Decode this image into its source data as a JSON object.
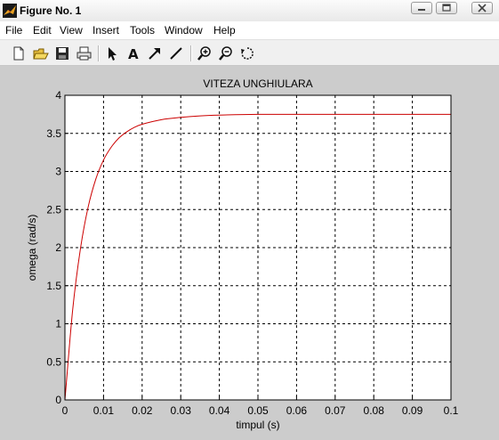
{
  "window": {
    "title": "Figure No. 1"
  },
  "menu": [
    "File",
    "Edit",
    "View",
    "Insert",
    "Tools",
    "Window",
    "Help"
  ],
  "toolbar": {
    "icons": [
      "new-figure-icon",
      "open-file-icon",
      "save-icon",
      "print-icon",
      "select-arrow-icon",
      "insert-text-icon",
      "insert-arrow-icon",
      "insert-line-icon",
      "zoom-in-icon",
      "zoom-out-icon",
      "rotate-3d-icon"
    ]
  },
  "colors": {
    "figure_bg": "#cccccc",
    "line": "#cc0000",
    "axes_bg": "#ffffff"
  },
  "chart_data": {
    "type": "line",
    "title": "VITEZA UNGHIULARA",
    "xlabel": "timpul (s)",
    "ylabel": "omega (rad/s)",
    "xlim": [
      0,
      0.1
    ],
    "ylim": [
      0,
      4
    ],
    "xticks": [
      0,
      0.01,
      0.02,
      0.03,
      0.04,
      0.05,
      0.06,
      0.07,
      0.08,
      0.09,
      0.1
    ],
    "xtick_labels": [
      "0",
      "0.01",
      "0.02",
      "0.03",
      "0.04",
      "0.05",
      "0.06",
      "0.07",
      "0.08",
      "0.09",
      "0.1"
    ],
    "yticks": [
      0,
      0.5,
      1,
      1.5,
      2,
      2.5,
      3,
      3.5,
      4
    ],
    "ytick_labels": [
      "0",
      "0.5",
      "1",
      "1.5",
      "2",
      "2.5",
      "3",
      "3.5",
      "4"
    ],
    "grid": true,
    "series": [
      {
        "x": [
          0,
          0.002,
          0.004,
          0.006,
          0.008,
          0.01,
          0.012,
          0.014,
          0.016,
          0.018,
          0.02,
          0.025,
          0.03,
          0.035,
          0.04,
          0.05,
          0.06,
          0.07,
          0.08,
          0.09,
          0.1
        ],
        "y": [
          0,
          1.18,
          1.98,
          2.53,
          2.9,
          3.15,
          3.32,
          3.44,
          3.52,
          3.58,
          3.62,
          3.68,
          3.71,
          3.73,
          3.74,
          3.75,
          3.75,
          3.75,
          3.75,
          3.75,
          3.75
        ]
      }
    ]
  }
}
